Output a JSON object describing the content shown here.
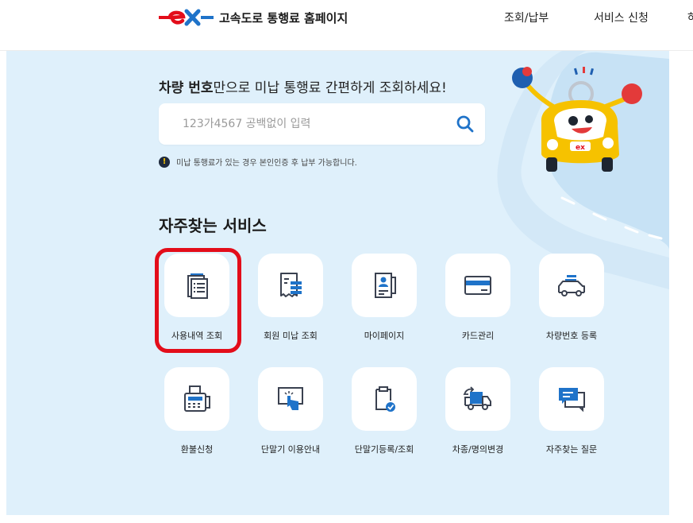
{
  "header": {
    "brand": "고속도로 통행료 홈페이지",
    "nav": [
      "조회/납부",
      "서비스 신청"
    ],
    "nav_clipped": "하"
  },
  "hero": {
    "headline_bold": "차량 번호",
    "headline_rest": "만으로 미납 통행료 간편하게 조회하세요!",
    "search": {
      "placeholder": "123가4567 공백없이 입력",
      "value": ""
    },
    "notice_mark": "!",
    "notice": "미납 통행료가 있는 경우 본인인증 후 납부 가능합니다."
  },
  "services": {
    "title": "자주찾는 서비스",
    "items": [
      {
        "label": "사용내역 조회",
        "icon": "usage-history-icon"
      },
      {
        "label": "회원 미납 조회",
        "icon": "receipt-icon"
      },
      {
        "label": "마이페이지",
        "icon": "profile-card-icon"
      },
      {
        "label": "카드관리",
        "icon": "credit-card-icon"
      },
      {
        "label": "차량번호 등록",
        "icon": "car-register-icon"
      },
      {
        "label": "환불신청",
        "icon": "fax-refund-icon"
      },
      {
        "label": "단말기 이용안내",
        "icon": "touch-terminal-icon"
      },
      {
        "label": "단말기등록/조회",
        "icon": "clipboard-check-icon"
      },
      {
        "label": "차종/명의변경",
        "icon": "truck-change-icon"
      },
      {
        "label": "자주찾는 질문",
        "icon": "chat-faq-icon"
      }
    ]
  },
  "colors": {
    "brand_red": "#e30d1a",
    "accent_blue": "#1f73c9",
    "background": "#dff0fb",
    "icon_dark": "#3a4150"
  }
}
